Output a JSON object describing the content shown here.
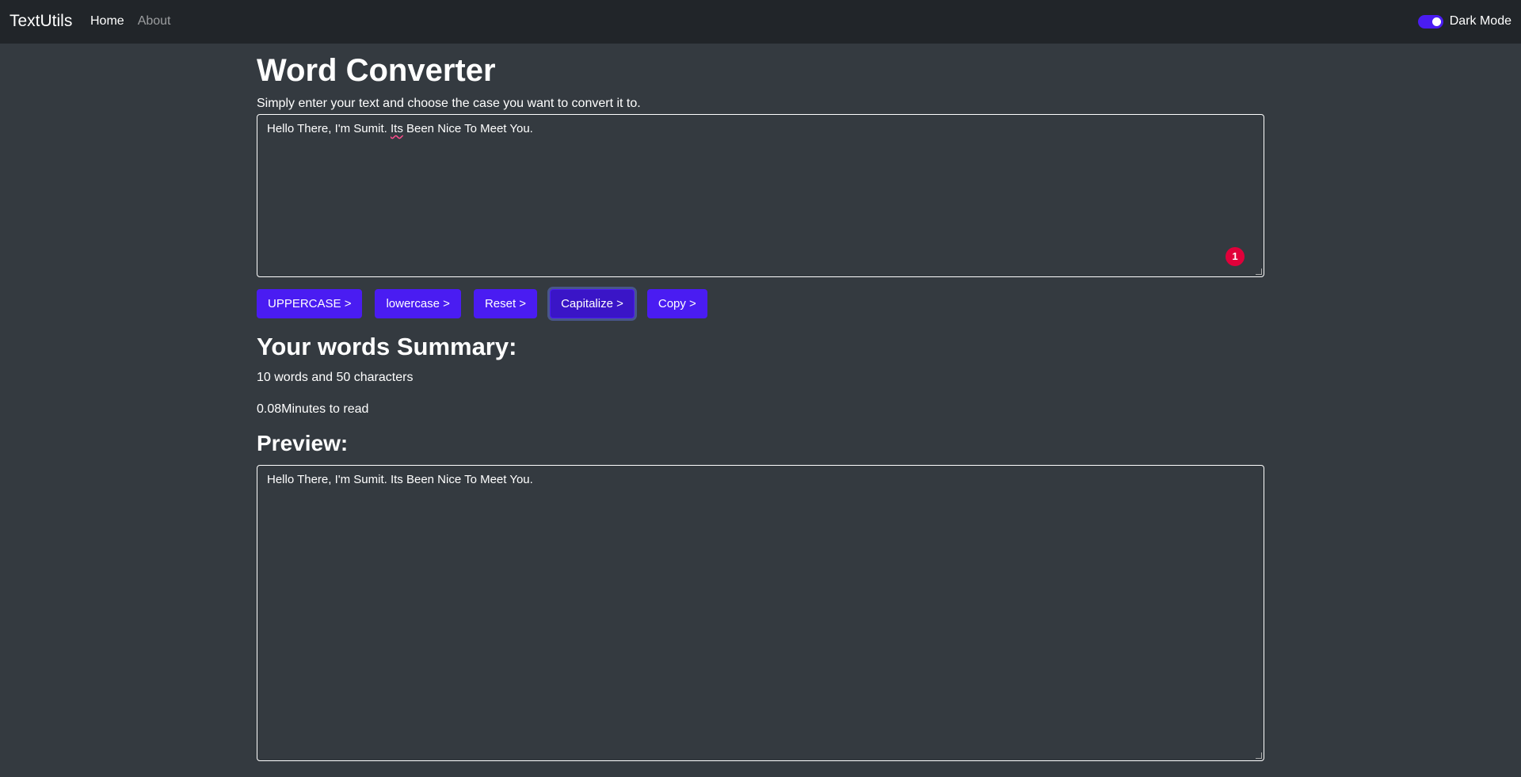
{
  "navbar": {
    "brand": "TextUtils",
    "links": [
      {
        "label": "Home",
        "active": true
      },
      {
        "label": "About",
        "active": false
      }
    ],
    "dark_mode_label": "Dark Mode",
    "dark_mode_enabled": true
  },
  "main": {
    "title": "Word Converter",
    "subtitle": "Simply enter your text and choose the case you want to convert it to.",
    "input_text_before": "Hello There, I'm Sumit. ",
    "input_text_flagged": "Its",
    "input_text_after": " Been Nice To Meet You.",
    "spellcheck_badge": "1",
    "buttons": {
      "uppercase": "UPPERCASE >",
      "lowercase": "lowercase >",
      "reset": "Reset >",
      "capitalize": "Capitalize >",
      "copy": "Copy >"
    },
    "summary_title": "Your words Summary:",
    "summary_words": "10 words and 50 characters",
    "summary_time": "0.08Minutes to read",
    "preview_title": "Preview:",
    "preview_text": "Hello There, I'm Sumit. Its Been Nice To Meet You."
  },
  "colors": {
    "background": "#343a40",
    "navbar": "#212529",
    "accent": "#4a1cf2",
    "badge": "#e0003a"
  }
}
